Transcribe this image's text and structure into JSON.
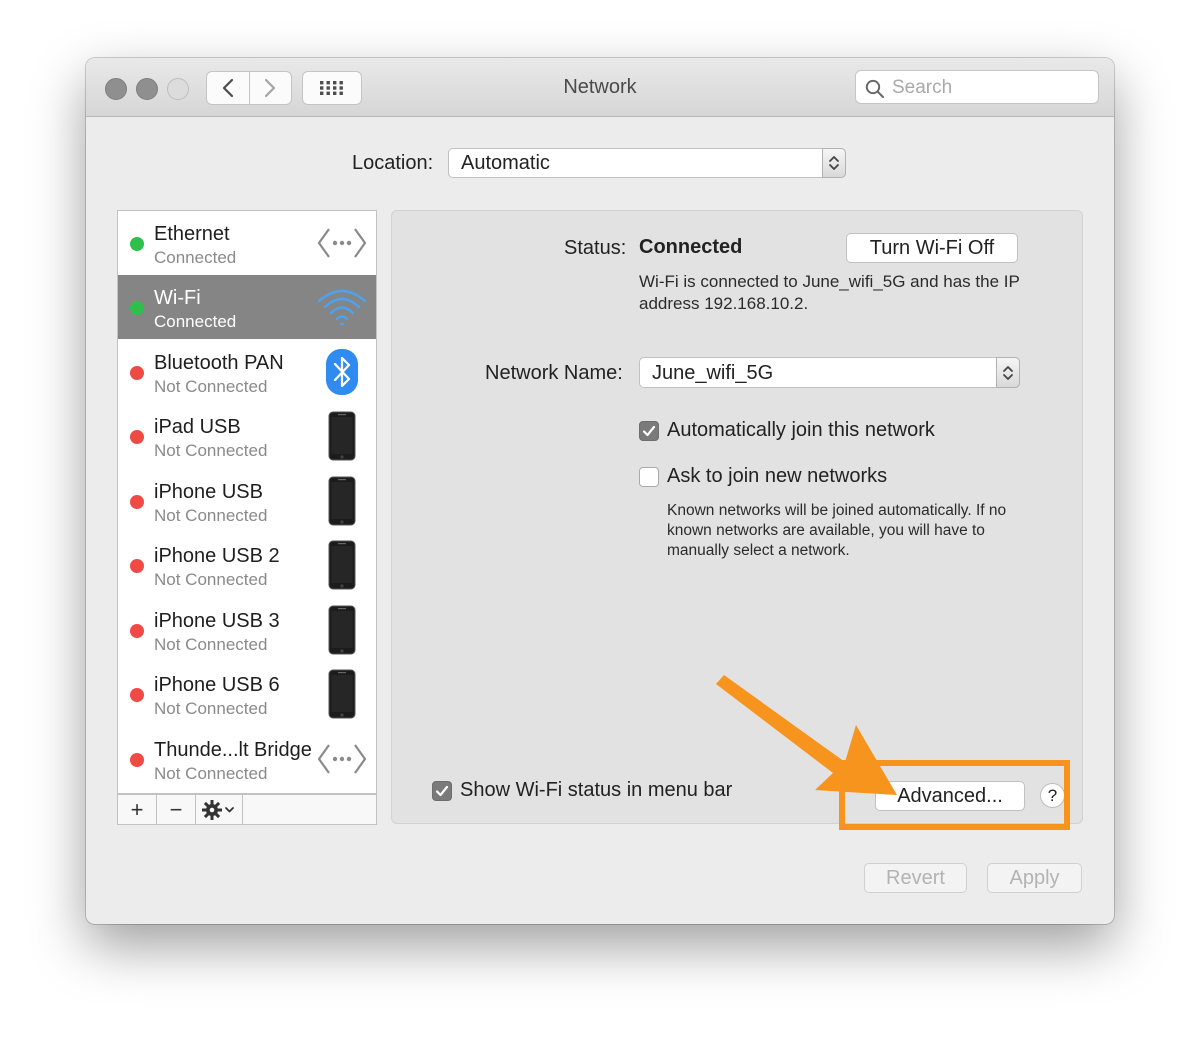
{
  "window": {
    "title": "Network",
    "search_placeholder": "Search"
  },
  "location": {
    "label": "Location:",
    "value": "Automatic"
  },
  "services": [
    {
      "name": "Ethernet",
      "status": "Connected",
      "dot": "green",
      "icon": "ethernet-icon",
      "selected": false
    },
    {
      "name": "Wi-Fi",
      "status": "Connected",
      "dot": "green",
      "icon": "wifi-icon",
      "selected": true
    },
    {
      "name": "Bluetooth PAN",
      "status": "Not Connected",
      "dot": "red",
      "icon": "bluetooth-icon",
      "selected": false
    },
    {
      "name": "iPad USB",
      "status": "Not Connected",
      "dot": "red",
      "icon": "iphone-icon",
      "selected": false
    },
    {
      "name": "iPhone USB",
      "status": "Not Connected",
      "dot": "red",
      "icon": "iphone-icon",
      "selected": false
    },
    {
      "name": "iPhone USB 2",
      "status": "Not Connected",
      "dot": "red",
      "icon": "iphone-icon",
      "selected": false
    },
    {
      "name": "iPhone USB 3",
      "status": "Not Connected",
      "dot": "red",
      "icon": "iphone-icon",
      "selected": false
    },
    {
      "name": "iPhone USB 6",
      "status": "Not Connected",
      "dot": "red",
      "icon": "iphone-icon",
      "selected": false
    },
    {
      "name": "Thunde...lt Bridge",
      "status": "Not Connected",
      "dot": "red",
      "icon": "ethernet-icon",
      "selected": false
    }
  ],
  "toolbar": {
    "add": "+",
    "remove": "−"
  },
  "detail": {
    "status_label": "Status:",
    "status_value": "Connected",
    "turn_off_button": "Turn Wi-Fi Off",
    "status_description": "Wi-Fi is connected to June_wifi_5G and has the IP address 192.168.10.2.",
    "network_name_label": "Network Name:",
    "network_name_value": "June_wifi_5G",
    "auto_join_label": "Automatically join this network",
    "auto_join_checked": true,
    "ask_join_label": "Ask to join new networks",
    "ask_join_checked": false,
    "known_networks_text": "Known networks will be joined automatically. If no known networks are available, you will have to manually select a network.",
    "show_status_label": "Show Wi-Fi status in menu bar",
    "show_status_checked": true,
    "advanced_button": "Advanced...",
    "help_button": "?"
  },
  "footer": {
    "revert_button": "Revert",
    "apply_button": "Apply"
  },
  "colors": {
    "connected_dot": "#2ec04a",
    "disconnected_dot": "#f04a44",
    "selected_row": "#858585",
    "annotation": "#f7941d",
    "wifi_icon": "#4aa3f3",
    "bluetooth_icon": "#2f8bf0"
  }
}
